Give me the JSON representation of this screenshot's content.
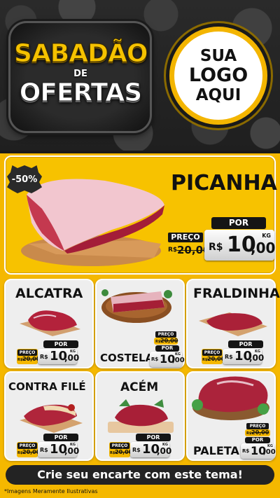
{
  "header": {
    "title_line1": "SABADÃO",
    "title_line2": "DE",
    "title_line3": "OFERTAS",
    "logo_line1": "SUA",
    "logo_line2": "LOGO",
    "logo_line3": "AQUI"
  },
  "featured": {
    "discount": "-50%",
    "name": "PICANHA",
    "preco_label": "PREÇO",
    "por_label": "POR",
    "old_currency": "R$",
    "old_price": "20,00",
    "new_currency": "R$",
    "new_price_int": "10",
    "new_price_dec": ",00",
    "unit": "KG"
  },
  "products": [
    {
      "name": "ALCATRA",
      "preco_label": "PREÇO",
      "por_label": "POR",
      "old_currency": "R$",
      "old_price": "20,00",
      "new_currency": "R$",
      "new_price_int": "10",
      "new_price_dec": ",00",
      "unit": "KG"
    },
    {
      "name": "COSTELA",
      "preco_label": "PREÇO",
      "por_label": "POR",
      "old_currency": "R$",
      "old_price": "20,00",
      "new_currency": "R$",
      "new_price_int": "10",
      "new_price_dec": ",00",
      "unit": "KG"
    },
    {
      "name": "FRALDINHA",
      "preco_label": "PREÇO",
      "por_label": "POR",
      "old_currency": "R$",
      "old_price": "20,00",
      "new_currency": "R$",
      "new_price_int": "10",
      "new_price_dec": ",00",
      "unit": "KG"
    },
    {
      "name": "CONTRA FILÉ",
      "preco_label": "PREÇO",
      "por_label": "POR",
      "old_currency": "R$",
      "old_price": "20,00",
      "new_currency": "R$",
      "new_price_int": "10",
      "new_price_dec": ",00",
      "unit": "KG"
    },
    {
      "name": "ACÉM",
      "preco_label": "PREÇO",
      "por_label": "POR",
      "old_currency": "R$",
      "old_price": "20,00",
      "new_currency": "R$",
      "new_price_int": "10",
      "new_price_dec": ",00",
      "unit": "KG"
    },
    {
      "name": "PALETA",
      "preco_label": "PREÇO",
      "por_label": "POR",
      "old_currency": "R$",
      "old_price": "20,00",
      "new_currency": "R$",
      "new_price_int": "10",
      "new_price_dec": ",00",
      "unit": "KG"
    }
  ],
  "cta": "Crie seu encarte com este tema!",
  "footnote": "*Imagens Meramente Ilustrativas",
  "colors": {
    "accent_yellow": "#f5b800",
    "dark": "#1a1a1a",
    "meat_red": "#b0203a"
  }
}
